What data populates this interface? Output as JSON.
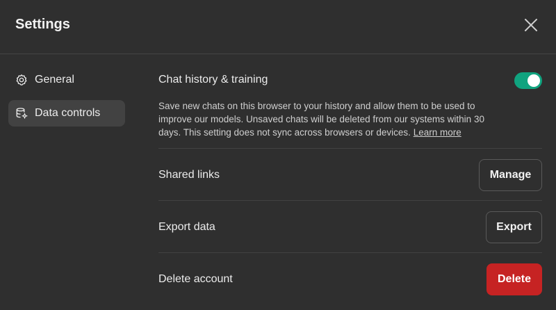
{
  "header": {
    "title": "Settings",
    "close_icon": "close-icon"
  },
  "sidebar": {
    "items": [
      {
        "label": "General",
        "icon": "gear-icon",
        "active": false
      },
      {
        "label": "Data controls",
        "icon": "database-settings-icon",
        "active": true
      }
    ]
  },
  "main": {
    "chat_history": {
      "title": "Chat history & training",
      "enabled": true,
      "description": "Save new chats on this browser to your history and allow them to be used to improve our models. Unsaved chats will be deleted from our systems within 30 days. This setting does not sync across browsers or devices.",
      "learn_more": "Learn more"
    },
    "shared_links": {
      "title": "Shared links",
      "button": "Manage"
    },
    "export_data": {
      "title": "Export data",
      "button": "Export"
    },
    "delete_account": {
      "title": "Delete account",
      "button": "Delete"
    }
  },
  "colors": {
    "background": "#2f2f2f",
    "active_nav": "#424242",
    "toggle_on": "#10a37f",
    "danger": "#c62323"
  }
}
